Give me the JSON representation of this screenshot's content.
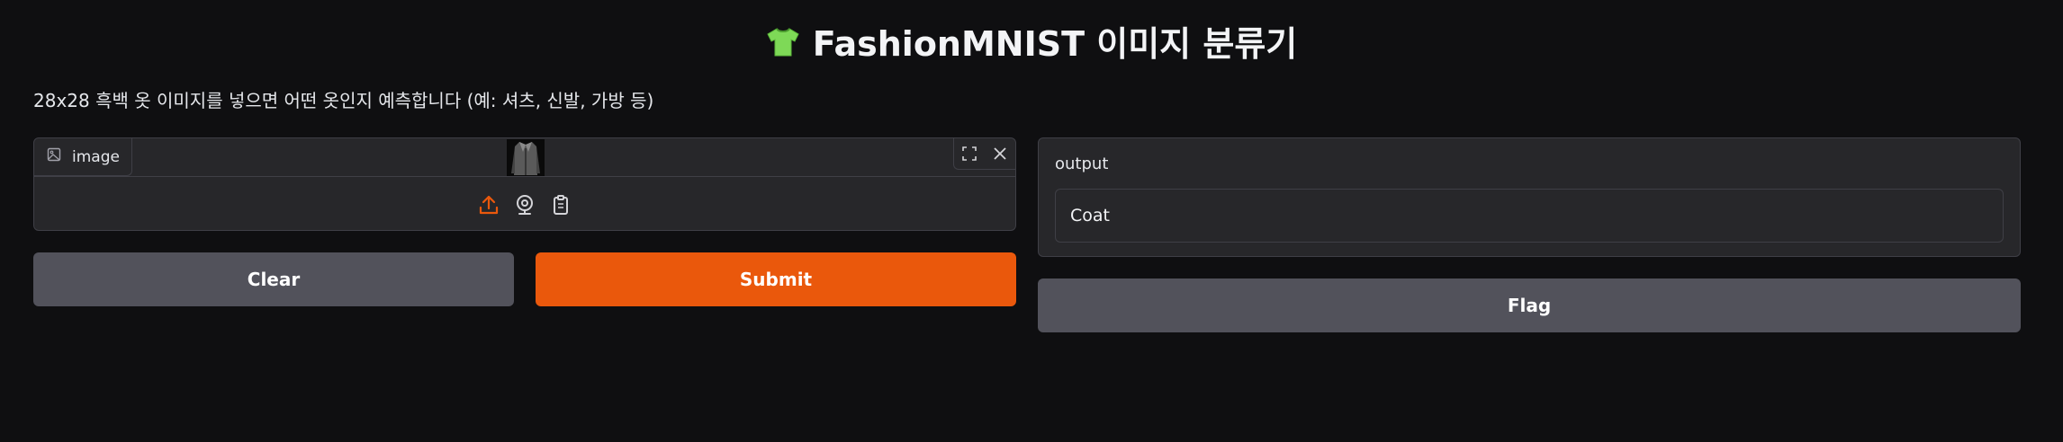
{
  "header": {
    "icon": "t-shirt-icon",
    "title": "FashionMNIST 이미지 분류기"
  },
  "description": "28x28 흑백 옷 이미지를 넣으면 어떤 옷인지 예측합니다 (예: 셔츠, 신발, 가방 등)",
  "image_input": {
    "label": "image",
    "label_icon": "image-icon",
    "thumbnail": "coat-thumbnail",
    "corner_buttons": [
      "fullscreen-icon",
      "close-icon"
    ],
    "sources": [
      "upload-icon",
      "webcam-icon",
      "clipboard-icon"
    ],
    "active_source_color": "#ea580c"
  },
  "buttons": {
    "clear": "Clear",
    "submit": "Submit",
    "flag": "Flag"
  },
  "output": {
    "label": "output",
    "value": "Coat"
  },
  "colors": {
    "primary": "#ea580c",
    "secondary": "#52525b",
    "panel": "#27272a",
    "background": "#0f0f11"
  }
}
